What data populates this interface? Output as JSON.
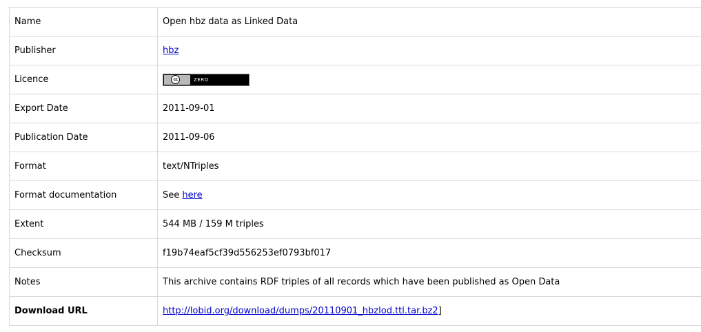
{
  "rows": [
    {
      "label": "Name",
      "value": "Open hbz data as Linked Data"
    },
    {
      "label": "Publisher",
      "link": "hbz"
    },
    {
      "label": "Licence",
      "badge": {
        "icon_text": "cc",
        "text": "ZERO"
      }
    },
    {
      "label": "Export Date",
      "value": "2011-09-01"
    },
    {
      "label": "Publication Date",
      "value": "2011-09-06"
    },
    {
      "label": "Format",
      "value": "text/NTriples"
    },
    {
      "label": "Format documentation",
      "prefix": "See",
      "link": "here"
    },
    {
      "label": "Extent",
      "value": "544 MB / 159 M triples"
    },
    {
      "label": "Checksum",
      "value": "f19b74eaf5cf39d556253ef0793bf017"
    },
    {
      "label": "Notes",
      "value": "This archive contains RDF triples of all records which have been published as Open Data"
    },
    {
      "label": "Download URL",
      "link": "http://lobid.org/download/dumps/20110901_hbzlod.ttl.tar.bz2",
      "suffix": "]"
    }
  ],
  "colors": {
    "border": "#d9d9d9",
    "link": "#0000cc",
    "text": "#000000"
  }
}
